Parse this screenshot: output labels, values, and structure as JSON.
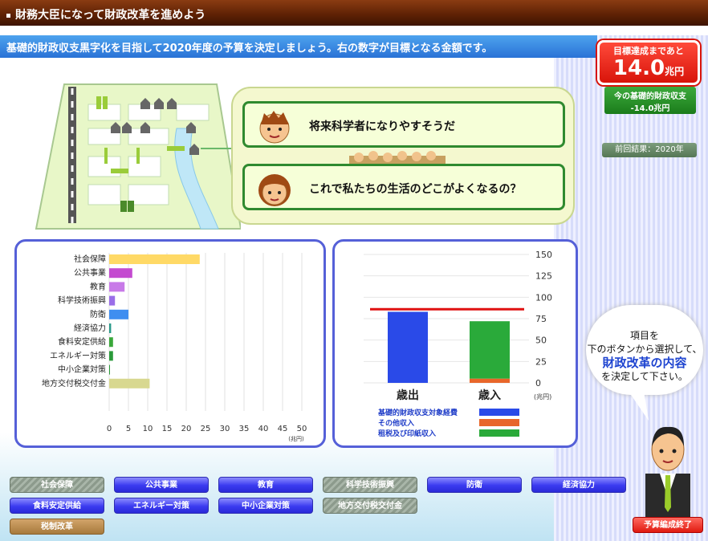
{
  "header": {
    "title": "財務大臣になって財政改革を進めよう"
  },
  "instruction": "基礎的財政収支黒字化を目指して2020年度の予算を決定しましょう。右の数字が目標となる金額です。",
  "goal": {
    "label": "目標達成まであと",
    "value": "14.0",
    "unit": "兆円"
  },
  "balance": {
    "label": "今の基礎的財政収支",
    "value": "-14.0兆円"
  },
  "prev_result": "前回結果：2020年",
  "bubbles": [
    {
      "text": "将来科学者になりやすそうだ"
    },
    {
      "text": "これで私たちの生活のどこがよくなるの？"
    }
  ],
  "callout": {
    "line1": "項目を",
    "line2": "下のボタンから選択して、",
    "line3": "財政改革の内容",
    "line4": "を決定して下さい。"
  },
  "chart_data": [
    {
      "type": "bar",
      "orientation": "horizontal",
      "categories": [
        "社会保障",
        "公共事業",
        "教育",
        "科学技術振興",
        "防衛",
        "経済協力",
        "食料安定供給",
        "エネルギー対策",
        "中小企業対策",
        "地方交付税交付金"
      ],
      "values": [
        23.5,
        6,
        4,
        1.5,
        5,
        0.5,
        1,
        1,
        0.2,
        10.5
      ],
      "colors": [
        "#ffd966",
        "#c44ad0",
        "#c87ae8",
        "#9a6ee8",
        "#3f8ef0",
        "#2a9a8a",
        "#3aa83a",
        "#2a9a3a",
        "#2a9a3a",
        "#d8d890"
      ],
      "xlim": [
        0,
        50
      ],
      "xticks": [
        0,
        5,
        10,
        15,
        20,
        25,
        30,
        35,
        40,
        45,
        50
      ],
      "xunit": "(兆円)"
    },
    {
      "type": "bar",
      "stacked": true,
      "categories": [
        "歳出",
        "歳入"
      ],
      "series": [
        {
          "name": "基礎的財政収支対象経費",
          "color": "#2a4ae8",
          "values": [
            83,
            0
          ]
        },
        {
          "name": "その他収入",
          "color": "#e8662a",
          "values": [
            0,
            5
          ]
        },
        {
          "name": "租税及び印紙収入",
          "color": "#2aaa3a",
          "values": [
            0,
            67
          ]
        }
      ],
      "target_line": 86,
      "ylim": [
        0,
        150
      ],
      "yticks": [
        0,
        25,
        50,
        75,
        100,
        125,
        150
      ],
      "yunit": "(兆円)"
    }
  ],
  "buttons": [
    {
      "label": "社会保障",
      "style": "hatch"
    },
    {
      "label": "公共事業",
      "style": "blue"
    },
    {
      "label": "教育",
      "style": "blue"
    },
    {
      "label": "科学技術振興",
      "style": "hatch"
    },
    {
      "label": "防衛",
      "style": "blue"
    },
    {
      "label": "経済協力",
      "style": "blue"
    },
    {
      "label": "食料安定供給",
      "style": "blue"
    },
    {
      "label": "エネルギー対策",
      "style": "blue"
    },
    {
      "label": "中小企業対策",
      "style": "blue"
    },
    {
      "label": "地方交付税交付金",
      "style": "hatch"
    },
    {
      "label": "税制改革",
      "style": "brown"
    }
  ],
  "finish_button": "予算編成終了"
}
